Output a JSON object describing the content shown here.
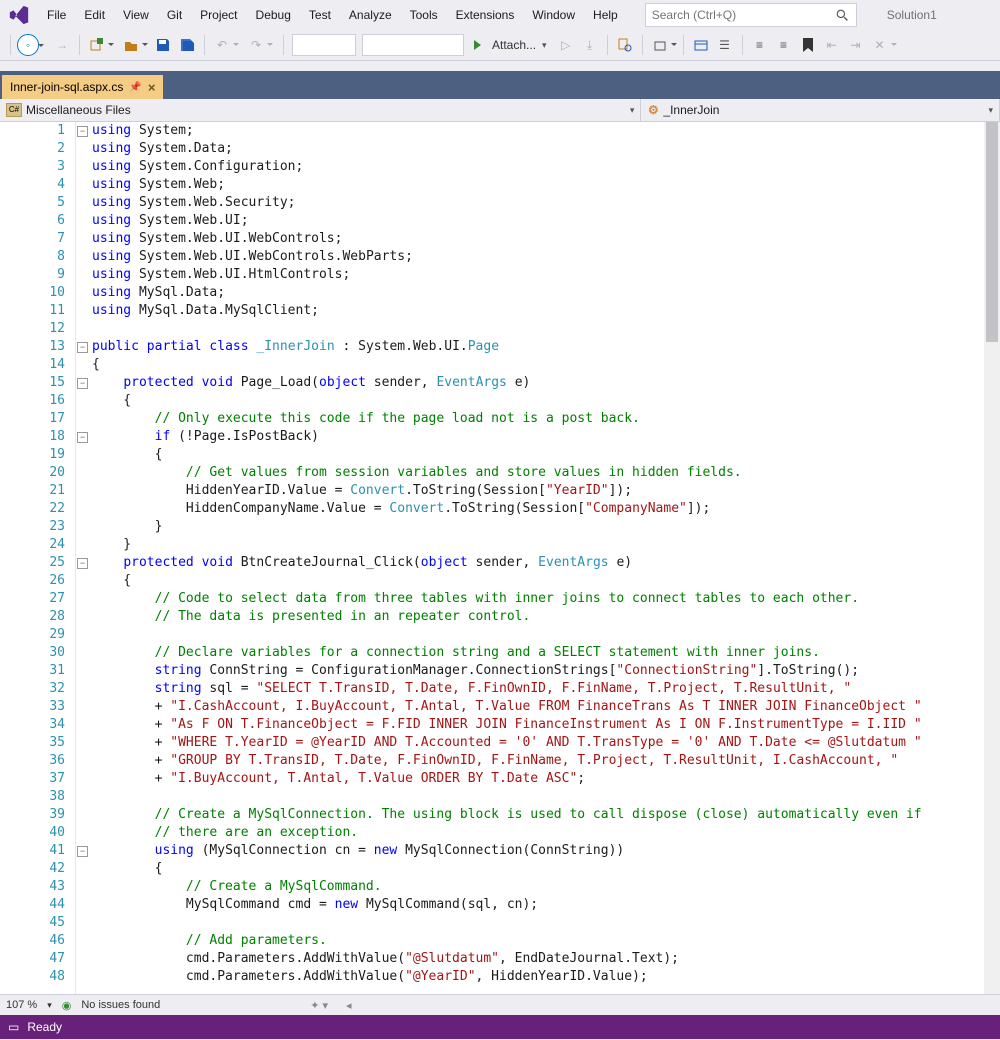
{
  "menu": [
    "File",
    "Edit",
    "View",
    "Git",
    "Project",
    "Debug",
    "Test",
    "Analyze",
    "Tools",
    "Extensions",
    "Window",
    "Help"
  ],
  "search": {
    "placeholder": "Search (Ctrl+Q)"
  },
  "solution": "Solution1",
  "attach_label": "Attach...",
  "tab": {
    "name": "Inner-join-sql.aspx.cs"
  },
  "nav": {
    "left": "Miscellaneous Files",
    "right": "_InnerJoin"
  },
  "status": {
    "zoom": "107 %",
    "issues": "No issues found",
    "ready": "Ready"
  },
  "code": [
    {
      "n": 1,
      "seg": [
        [
          "kw",
          "using"
        ],
        [
          "",
          " System;"
        ]
      ]
    },
    {
      "n": 2,
      "seg": [
        [
          "kw",
          "using"
        ],
        [
          "",
          " System.Data;"
        ]
      ]
    },
    {
      "n": 3,
      "seg": [
        [
          "kw",
          "using"
        ],
        [
          "",
          " System.Configuration;"
        ]
      ]
    },
    {
      "n": 4,
      "seg": [
        [
          "kw",
          "using"
        ],
        [
          "",
          " System.Web;"
        ]
      ]
    },
    {
      "n": 5,
      "seg": [
        [
          "kw",
          "using"
        ],
        [
          "",
          " System.Web.Security;"
        ]
      ]
    },
    {
      "n": 6,
      "seg": [
        [
          "kw",
          "using"
        ],
        [
          "",
          " System.Web.UI;"
        ]
      ]
    },
    {
      "n": 7,
      "seg": [
        [
          "kw",
          "using"
        ],
        [
          "",
          " System.Web.UI.WebControls;"
        ]
      ]
    },
    {
      "n": 8,
      "seg": [
        [
          "kw",
          "using"
        ],
        [
          "",
          " System.Web.UI.WebControls.WebParts;"
        ]
      ]
    },
    {
      "n": 9,
      "seg": [
        [
          "kw",
          "using"
        ],
        [
          "",
          " System.Web.UI.HtmlControls;"
        ]
      ]
    },
    {
      "n": 10,
      "seg": [
        [
          "kw",
          "using"
        ],
        [
          "",
          " MySql.Data;"
        ]
      ]
    },
    {
      "n": 11,
      "seg": [
        [
          "kw",
          "using"
        ],
        [
          "",
          " MySql.Data.MySqlClient;"
        ]
      ]
    },
    {
      "n": 12,
      "seg": [
        [
          "",
          ""
        ]
      ]
    },
    {
      "n": 13,
      "seg": [
        [
          "kw",
          "public"
        ],
        [
          "",
          " "
        ],
        [
          "kw",
          "partial"
        ],
        [
          "",
          " "
        ],
        [
          "kw",
          "class"
        ],
        [
          "",
          " "
        ],
        [
          "cls",
          "_InnerJoin"
        ],
        [
          "",
          " : System.Web.UI."
        ],
        [
          "cls",
          "Page"
        ]
      ]
    },
    {
      "n": 14,
      "seg": [
        [
          "",
          "{"
        ]
      ]
    },
    {
      "n": 15,
      "seg": [
        [
          "",
          "    "
        ],
        [
          "kw",
          "protected"
        ],
        [
          "",
          " "
        ],
        [
          "kw",
          "void"
        ],
        [
          "",
          " "
        ],
        [
          "",
          "Page_Load("
        ],
        [
          "kw",
          "object"
        ],
        [
          "",
          " sender, "
        ],
        [
          "cls",
          "EventArgs"
        ],
        [
          "",
          " e)"
        ]
      ]
    },
    {
      "n": 16,
      "seg": [
        [
          "",
          "    {"
        ]
      ]
    },
    {
      "n": 17,
      "seg": [
        [
          "",
          "        "
        ],
        [
          "com",
          "// Only execute this code if the page load not is a post back."
        ]
      ]
    },
    {
      "n": 18,
      "seg": [
        [
          "",
          "        "
        ],
        [
          "kw",
          "if"
        ],
        [
          "",
          " (!Page.IsPostBack)"
        ]
      ]
    },
    {
      "n": 19,
      "seg": [
        [
          "",
          "        {"
        ]
      ]
    },
    {
      "n": 20,
      "seg": [
        [
          "",
          "            "
        ],
        [
          "com",
          "// Get values from session variables and store values in hidden fields."
        ]
      ]
    },
    {
      "n": 21,
      "seg": [
        [
          "",
          "            HiddenYearID.Value = "
        ],
        [
          "cls",
          "Convert"
        ],
        [
          "",
          ".ToString(Session["
        ],
        [
          "str",
          "\"YearID\""
        ],
        [
          "",
          "]);"
        ]
      ]
    },
    {
      "n": 22,
      "seg": [
        [
          "",
          "            HiddenCompanyName.Value = "
        ],
        [
          "cls",
          "Convert"
        ],
        [
          "",
          ".ToString(Session["
        ],
        [
          "str",
          "\"CompanyName\""
        ],
        [
          "",
          "]);"
        ]
      ]
    },
    {
      "n": 23,
      "seg": [
        [
          "",
          "        }"
        ]
      ]
    },
    {
      "n": 24,
      "seg": [
        [
          "",
          "    }"
        ]
      ]
    },
    {
      "n": 25,
      "seg": [
        [
          "",
          "    "
        ],
        [
          "kw",
          "protected"
        ],
        [
          "",
          " "
        ],
        [
          "kw",
          "void"
        ],
        [
          "",
          " BtnCreateJournal_Click("
        ],
        [
          "kw",
          "object"
        ],
        [
          "",
          " sender, "
        ],
        [
          "cls",
          "EventArgs"
        ],
        [
          "",
          " e)"
        ]
      ]
    },
    {
      "n": 26,
      "seg": [
        [
          "",
          "    {"
        ]
      ]
    },
    {
      "n": 27,
      "seg": [
        [
          "",
          "        "
        ],
        [
          "com",
          "// Code to select data from three tables with inner joins to connect tables to each other."
        ]
      ]
    },
    {
      "n": 28,
      "seg": [
        [
          "",
          "        "
        ],
        [
          "com",
          "// The data is presented in an repeater control."
        ]
      ]
    },
    {
      "n": 29,
      "seg": [
        [
          "",
          ""
        ]
      ]
    },
    {
      "n": 30,
      "seg": [
        [
          "",
          "        "
        ],
        [
          "com",
          "// Declare variables for a connection string and a SELECT statement with inner joins."
        ]
      ]
    },
    {
      "n": 31,
      "seg": [
        [
          "",
          "        "
        ],
        [
          "kw",
          "string"
        ],
        [
          "",
          " ConnString = ConfigurationManager.ConnectionStrings["
        ],
        [
          "str",
          "\"ConnectionString\""
        ],
        [
          "",
          "].ToString();"
        ]
      ]
    },
    {
      "n": 32,
      "seg": [
        [
          "",
          "        "
        ],
        [
          "kw",
          "string"
        ],
        [
          "",
          " sql = "
        ],
        [
          "str",
          "\"SELECT T.TransID, T.Date, F.FinOwnID, F.FinName, T.Project, T.ResultUnit, \""
        ]
      ]
    },
    {
      "n": 33,
      "seg": [
        [
          "",
          "        + "
        ],
        [
          "str",
          "\"I.CashAccount, I.BuyAccount, T.Antal, T.Value FROM FinanceTrans As T INNER JOIN FinanceObject \""
        ]
      ]
    },
    {
      "n": 34,
      "seg": [
        [
          "",
          "        + "
        ],
        [
          "str",
          "\"As F ON T.FinanceObject = F.FID INNER JOIN FinanceInstrument As I ON F.InstrumentType = I.IID \""
        ]
      ]
    },
    {
      "n": 35,
      "seg": [
        [
          "",
          "        + "
        ],
        [
          "str",
          "\"WHERE T.YearID = @YearID AND T.Accounted = '0' AND T.TransType = '0' AND T.Date <= @Slutdatum \""
        ]
      ]
    },
    {
      "n": 36,
      "seg": [
        [
          "",
          "        + "
        ],
        [
          "str",
          "\"GROUP BY T.TransID, T.Date, F.FinOwnID, F.FinName, T.Project, T.ResultUnit, I.CashAccount, \""
        ]
      ]
    },
    {
      "n": 37,
      "seg": [
        [
          "",
          "        + "
        ],
        [
          "str",
          "\"I.BuyAccount, T.Antal, T.Value ORDER BY T.Date ASC\""
        ],
        [
          "",
          ";"
        ]
      ]
    },
    {
      "n": 38,
      "seg": [
        [
          "",
          ""
        ]
      ]
    },
    {
      "n": 39,
      "seg": [
        [
          "",
          "        "
        ],
        [
          "com",
          "// Create a MySqlConnection. The using block is used to call dispose (close) automatically even if"
        ]
      ]
    },
    {
      "n": 40,
      "seg": [
        [
          "",
          "        "
        ],
        [
          "com",
          "// there are an exception."
        ]
      ]
    },
    {
      "n": 41,
      "seg": [
        [
          "",
          "        "
        ],
        [
          "kw",
          "using"
        ],
        [
          "",
          " (MySqlConnection cn = "
        ],
        [
          "kw",
          "new"
        ],
        [
          "",
          " MySqlConnection(ConnString))"
        ]
      ]
    },
    {
      "n": 42,
      "seg": [
        [
          "",
          "        {"
        ]
      ]
    },
    {
      "n": 43,
      "seg": [
        [
          "",
          "            "
        ],
        [
          "com",
          "// Create a MySqlCommand."
        ]
      ]
    },
    {
      "n": 44,
      "seg": [
        [
          "",
          "            MySqlCommand cmd = "
        ],
        [
          "kw",
          "new"
        ],
        [
          "",
          " MySqlCommand(sql, cn);"
        ]
      ]
    },
    {
      "n": 45,
      "seg": [
        [
          "",
          ""
        ]
      ]
    },
    {
      "n": 46,
      "seg": [
        [
          "",
          "            "
        ],
        [
          "com",
          "// Add parameters."
        ]
      ]
    },
    {
      "n": 47,
      "seg": [
        [
          "",
          "            cmd.Parameters.AddWithValue("
        ],
        [
          "str",
          "\"@Slutdatum\""
        ],
        [
          "",
          ", EndDateJournal.Text);"
        ]
      ]
    },
    {
      "n": 48,
      "seg": [
        [
          "",
          "            cmd.Parameters.AddWithValue("
        ],
        [
          "str",
          "\"@YearID\""
        ],
        [
          "",
          ", HiddenYearID.Value);"
        ]
      ]
    }
  ],
  "folds": [
    1,
    13,
    15,
    18,
    25,
    41
  ]
}
